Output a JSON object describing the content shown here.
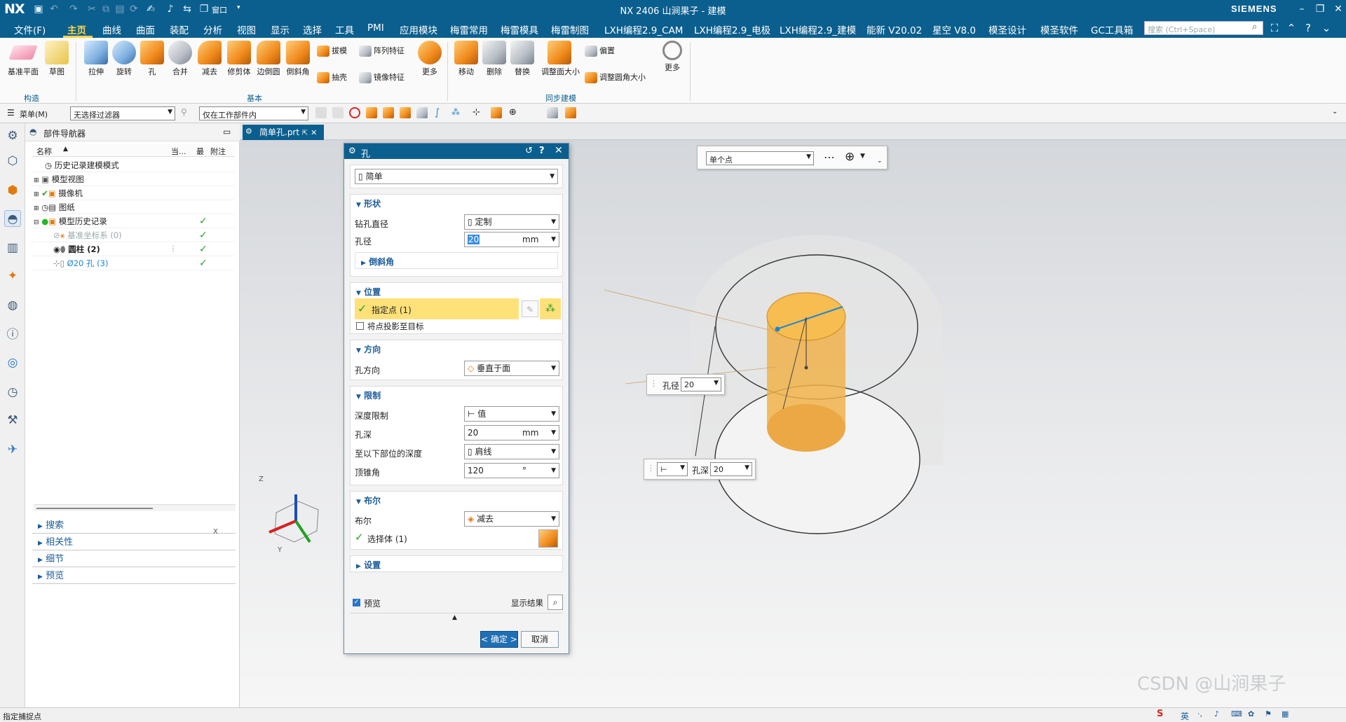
{
  "title_bar": {
    "logo": "NX",
    "title": "NX 2406 山涧果子 - 建模",
    "brand": "SIEMENS",
    "window_menu": "窗口"
  },
  "menu": {
    "items": [
      "文件(F)",
      "主页",
      "曲线",
      "曲面",
      "装配",
      "分析",
      "视图",
      "显示",
      "选择",
      "工具",
      "PMI",
      "应用模块",
      "梅雷常用",
      "梅雷模具",
      "梅雷制图",
      "LXH编程2.9_CAM",
      "LXH编程2.9_电极",
      "LXH编程2.9_建模",
      "能新 V20.02",
      "星空 V8.0",
      "模圣设计",
      "模圣软件",
      "GC工具箱"
    ],
    "active": "主页",
    "search_placeholder": "搜索 (Ctrl+Space)"
  },
  "ribbon": {
    "construct": {
      "datum_plane": "基准平面",
      "sketch": "草图",
      "group": "构造"
    },
    "basic": {
      "extrude": "拉伸",
      "revolve": "旋转",
      "hole": "孔",
      "unite": "合并",
      "subtract": "减去",
      "trim_body": "修剪体",
      "edge_blend": "边倒圆",
      "chamfer": "倒斜角",
      "draft": "拔模",
      "shell": "抽壳",
      "pattern_feature": "阵列特征",
      "mirror_feature": "镜像特征",
      "more": "更多",
      "group": "基本"
    },
    "sync": {
      "move": "移动",
      "delete": "删除",
      "replace": "替换",
      "resize_face": "调整面大小",
      "offset": "偏置",
      "resize_blend": "调整圆角大小",
      "more": "更多",
      "group": "同步建模"
    }
  },
  "toolbar": {
    "menu_label": "菜单(M)",
    "filter": "无选择过滤器",
    "scope": "仅在工作部件内"
  },
  "navigator": {
    "title": "部件导航器",
    "columns": [
      "名称",
      "当...",
      "最",
      "附注"
    ],
    "rows": [
      {
        "label": "历史记录建模模式",
        "indent": 0,
        "check": false
      },
      {
        "label": "模型视图",
        "indent": 0,
        "check": false
      },
      {
        "label": "摄像机",
        "indent": 0,
        "check": false
      },
      {
        "label": "图纸",
        "indent": 0,
        "check": false
      },
      {
        "label": "模型历史记录",
        "indent": 0,
        "check": true
      },
      {
        "label": "基准坐标系 (0)",
        "indent": 1,
        "check": true
      },
      {
        "label": "圆柱 (2)",
        "indent": 1,
        "check": true
      },
      {
        "label": "Ø20 孔 (3)",
        "indent": 1,
        "check": true
      }
    ],
    "panels": [
      "搜索",
      "相关性",
      "细节",
      "预览"
    ]
  },
  "file_tab": "简单孔.prt",
  "dialog": {
    "title": "孔",
    "type": "简单",
    "shape": {
      "header": "形状",
      "drill_size_label": "钻孔直径",
      "drill_size_value": "定制",
      "diameter_label": "孔径",
      "diameter_value": "20",
      "diameter_unit": "mm",
      "chamfer_header": "倒斜角"
    },
    "position": {
      "header": "位置",
      "specify_point": "指定点 (1)",
      "project_label": "将点投影至目标"
    },
    "direction": {
      "header": "方向",
      "label": "孔方向",
      "value": "垂直于面"
    },
    "limit": {
      "header": "限制",
      "depth_limit_label": "深度限制",
      "depth_limit_value": "值",
      "depth_label": "孔深",
      "depth_value": "20",
      "depth_unit": "mm",
      "depth_to_label": "至以下部位的深度",
      "depth_to_value": "肩线",
      "tip_angle_label": "顶锥角",
      "tip_angle_value": "120",
      "tip_angle_unit": "°"
    },
    "boolean": {
      "header": "布尔",
      "label": "布尔",
      "value": "减去",
      "select_body": "选择体 (1)"
    },
    "settings": {
      "header": "设置"
    },
    "preview": {
      "label": "预览",
      "show_result": "显示结果"
    },
    "ok": "< 确定 >",
    "cancel": "取消"
  },
  "viewport": {
    "point_type": "单个点",
    "callout_diameter_label": "孔径",
    "callout_diameter_value": "20",
    "callout_depth_label": "孔深",
    "callout_depth_value": "20",
    "triad": {
      "x": "X",
      "y": "Y",
      "z": "Z"
    },
    "watermark": "CSDN @山涧果子"
  },
  "status_bar": {
    "text": "指定捕捉点",
    "ime": "英"
  }
}
